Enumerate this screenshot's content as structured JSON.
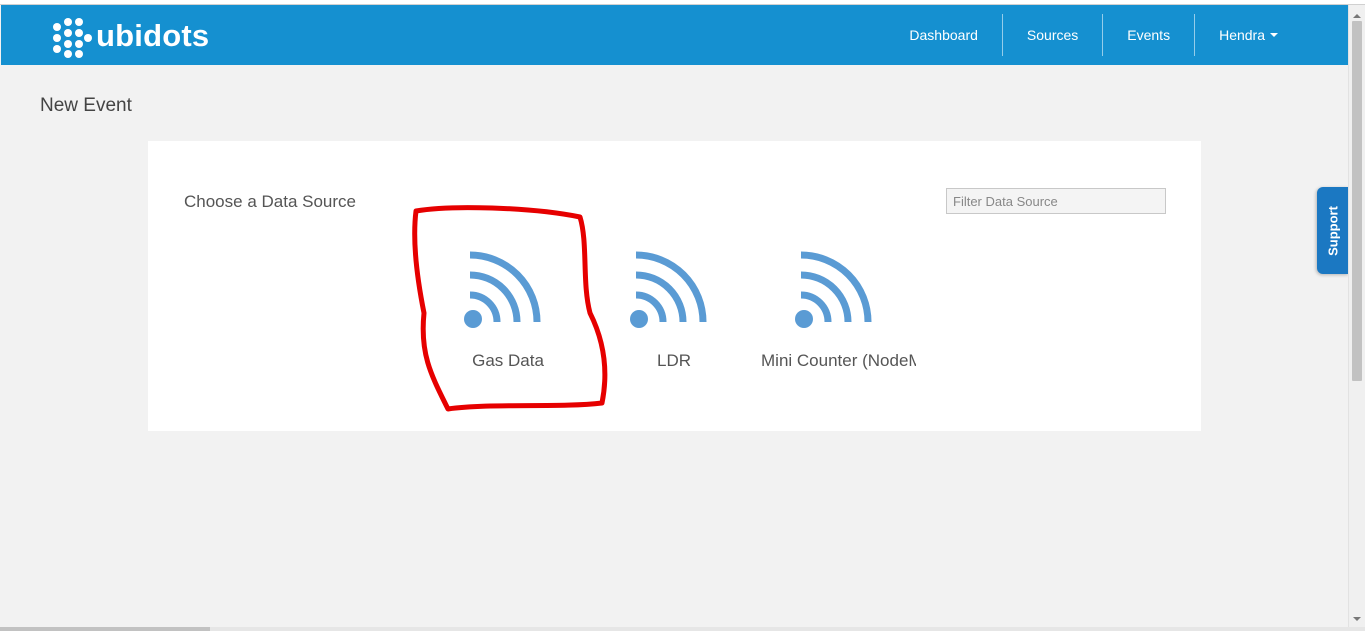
{
  "brand": {
    "name": "ubidots"
  },
  "nav": {
    "items": [
      {
        "label": "Dashboard"
      },
      {
        "label": "Sources"
      },
      {
        "label": "Events"
      }
    ],
    "user": {
      "label": "Hendra"
    }
  },
  "page": {
    "title": "New Event"
  },
  "panel": {
    "title": "Choose a Data Source",
    "filter": {
      "placeholder": "Filter Data Source",
      "value": ""
    },
    "sources": [
      {
        "label": "Gas Data",
        "icon": "wifi-signal-icon"
      },
      {
        "label": "LDR",
        "icon": "wifi-signal-icon"
      },
      {
        "label": "Mini Counter (NodeMCU)",
        "icon": "wifi-signal-icon"
      }
    ]
  },
  "support": {
    "label": "Support"
  },
  "colors": {
    "navbar": "#1590d0",
    "icon": "#5a9bd4",
    "annotation": "#e60000",
    "support": "#1b78c2"
  }
}
